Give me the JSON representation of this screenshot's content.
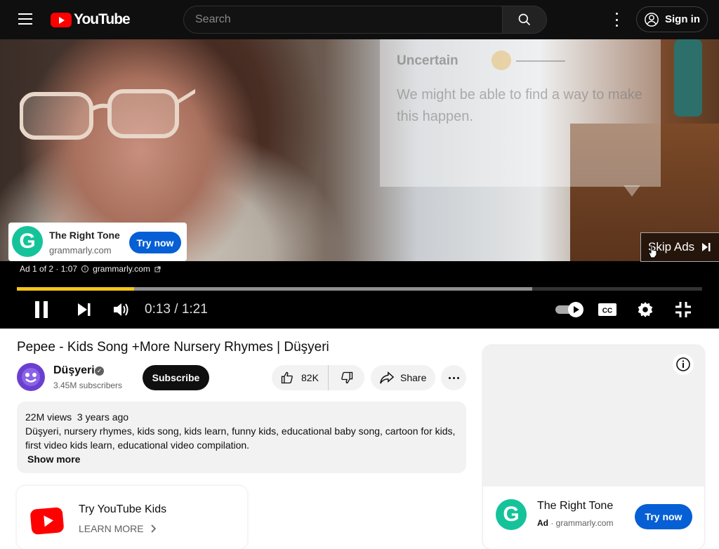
{
  "header": {
    "logo_text": "YouTube",
    "search_placeholder": "Search",
    "signin_label": "Sign in"
  },
  "player": {
    "overlay": {
      "title": "Uncertain",
      "text": "We might be able to find a way to make this happen."
    },
    "ad_card": {
      "title": "The Right Tone",
      "domain": "grammarly.com",
      "cta": "Try now"
    },
    "skip_label": "Skip Ads",
    "ad_meta": {
      "counter": "Ad 1 of 2 · 1:07",
      "domain": "grammarly.com"
    },
    "time": "0:13 / 1:21",
    "played_fraction": 0.171,
    "buffered_fraction": 0.752,
    "accent_color": "#f5c518"
  },
  "video": {
    "title": "Pepee - Kids Song +More Nursery Rhymes | Düşyeri",
    "channel_name": "Düşyeri",
    "subscribers": "3.45M subscribers",
    "subscribe_label": "Subscribe",
    "likes": "82K",
    "share_label": "Share"
  },
  "description": {
    "stats": "22M views  3 years ago",
    "text": "Düşyeri, nursery rhymes, kids song, kids learn, funny kids, educational baby song, cartoon for kids, first video kids learn, educational video compilation.",
    "show_more": "Show more"
  },
  "ytkids": {
    "title": "Try YouTube Kids",
    "learn_more": "LEARN MORE"
  },
  "side_ad": {
    "title": "The Right Tone",
    "ad_label": "Ad",
    "domain": "grammarly.com",
    "cta": "Try now"
  },
  "icons": [
    "menu-icon",
    "youtube-logo-icon",
    "search-icon",
    "more-vert-icon",
    "account-icon",
    "grammarly-icon",
    "skip-icon",
    "pause-icon",
    "next-icon",
    "volume-icon",
    "autoplay-toggle-icon",
    "captions-icon",
    "settings-icon",
    "exit-fullscreen-icon",
    "thumb-up-icon",
    "thumb-down-icon",
    "share-icon",
    "more-horiz-icon",
    "info-icon",
    "chevron-right-icon",
    "external-link-icon",
    "verified-icon"
  ]
}
